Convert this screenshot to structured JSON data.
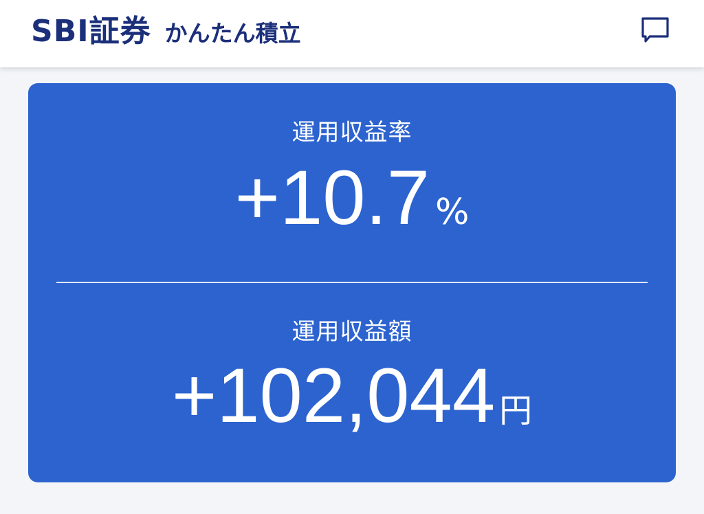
{
  "header": {
    "brand_logo": "SBI証券",
    "service_name": "かんたん積立",
    "chat_icon": "chat-bubble-icon",
    "brand_color": "#1b2f7a"
  },
  "summary_card": {
    "background_color": "#2c63cf",
    "return_rate": {
      "label": "運用収益率",
      "value": "+10.7",
      "unit": "%"
    },
    "return_amount": {
      "label": "運用収益額",
      "value": "+102,044",
      "unit": "円"
    }
  }
}
